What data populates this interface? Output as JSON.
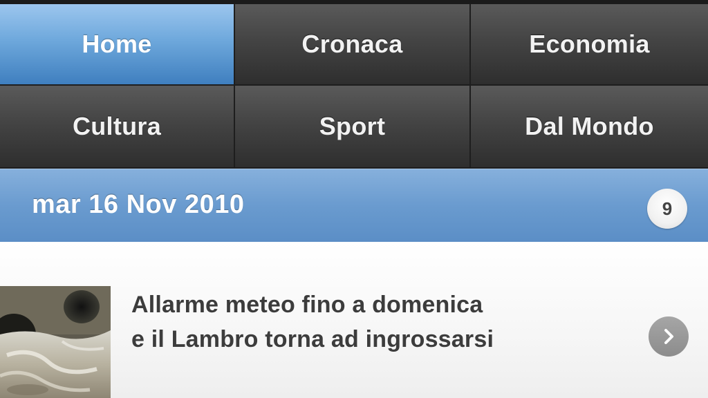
{
  "nav": {
    "tabs": [
      {
        "label": "Home",
        "active": true
      },
      {
        "label": "Cronaca",
        "active": false
      },
      {
        "label": "Economia",
        "active": false
      },
      {
        "label": "Cultura",
        "active": false
      },
      {
        "label": "Sport",
        "active": false
      },
      {
        "label": "Dal Mondo",
        "active": false
      }
    ]
  },
  "date_header": {
    "date": "mar 16 Nov 2010",
    "count": "9"
  },
  "news": [
    {
      "headline_line1": "Allarme meteo fino a domenica",
      "headline_line2": "e il Lambro torna ad ingrossarsi",
      "thumbnail_icon": "river-photo"
    }
  ],
  "colors": {
    "active_tab": "#6ea8dc",
    "tab_dark": "#444444",
    "date_bar": "#6a9bcf",
    "headline_text": "#3c3c3c"
  }
}
